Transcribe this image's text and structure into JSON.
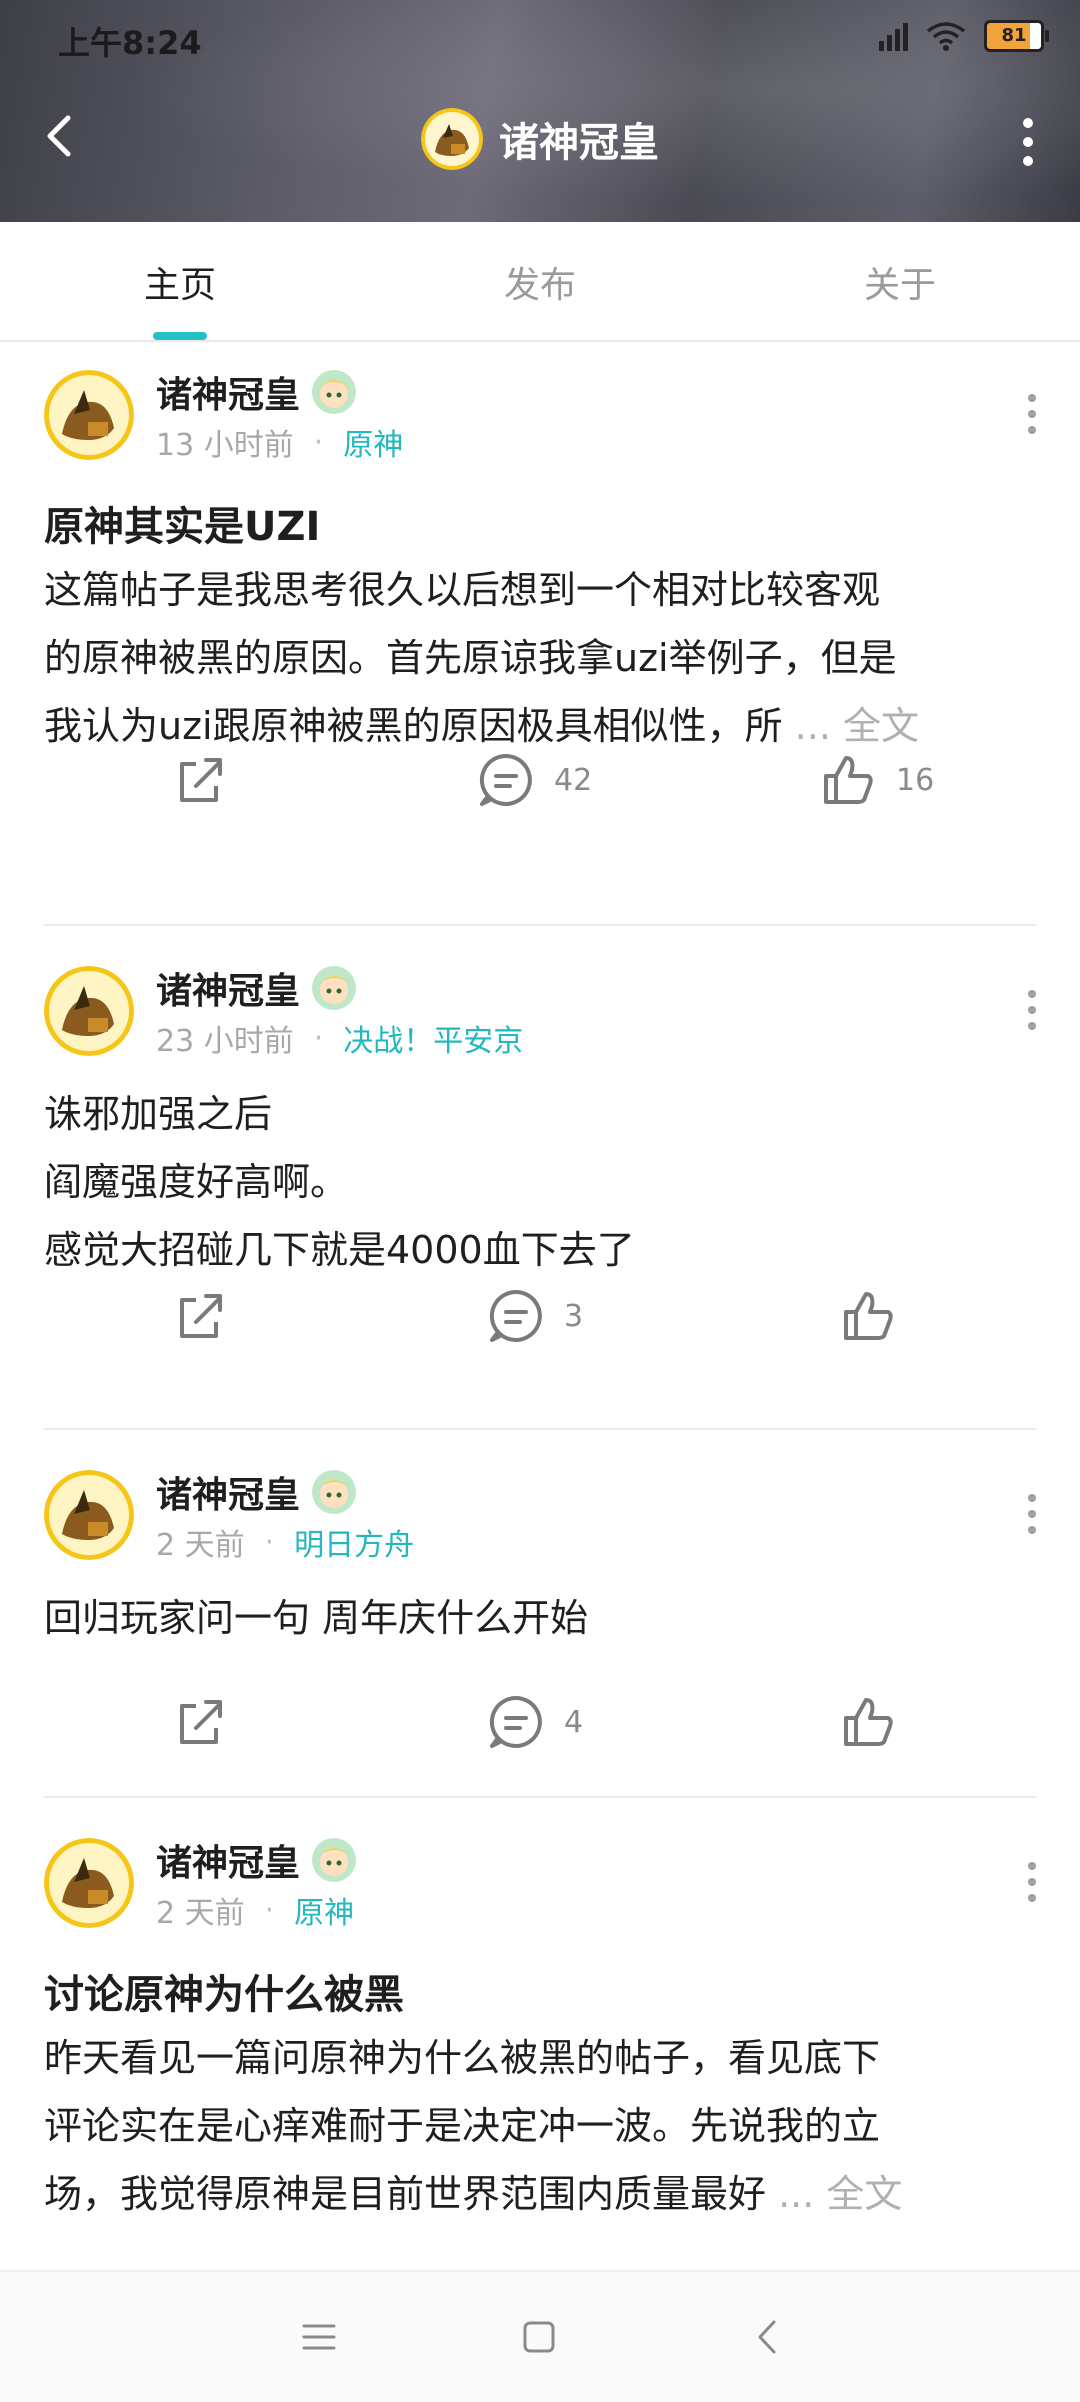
{
  "status": {
    "time": "上午8:24",
    "battery": "81"
  },
  "header": {
    "title": "诸神冠皇"
  },
  "tabs": [
    {
      "label": "主页",
      "active": true
    },
    {
      "label": "发布",
      "active": false
    },
    {
      "label": "关于",
      "active": false
    }
  ],
  "posts": [
    {
      "author": "诸神冠皇",
      "time": "13 小时前",
      "topic": "原神",
      "title": "原神其实是UZI",
      "lines": [
        "这篇帖子是我思考很久以后想到一个相对比较客观",
        "的原神被黑的原因。首先原谅我拿uzi举例子，但是",
        "我认为uzi跟原神被黑的原因极具相似性，所 "
      ],
      "more": "... 全文",
      "comments": "42",
      "likes": "16"
    },
    {
      "author": "诸神冠皇",
      "time": "23 小时前",
      "topic": "决战！平安京",
      "lines": [
        "诛邪加强之后",
        "阎魔强度好高啊。",
        "感觉大招碰几下就是4000血下去了"
      ],
      "comments": "3",
      "likes": ""
    },
    {
      "author": "诸神冠皇",
      "time": "2 天前",
      "topic": "明日方舟",
      "lines": [
        "回归玩家问一句 周年庆什么开始"
      ],
      "comments": "4",
      "likes": ""
    },
    {
      "author": "诸神冠皇",
      "time": "2 天前",
      "topic": "原神",
      "title": "讨论原神为什么被黑",
      "lines": [
        "昨天看见一篇问原神为什么被黑的帖子，看见底下",
        "评论实在是心痒难耐于是决定冲一波。先说我的立",
        "场，我觉得原神是目前世界范围内质量最好 "
      ],
      "more": "... 全文"
    }
  ],
  "colors": {
    "accent": "#23c0c6",
    "topic": "#23b7c0"
  }
}
